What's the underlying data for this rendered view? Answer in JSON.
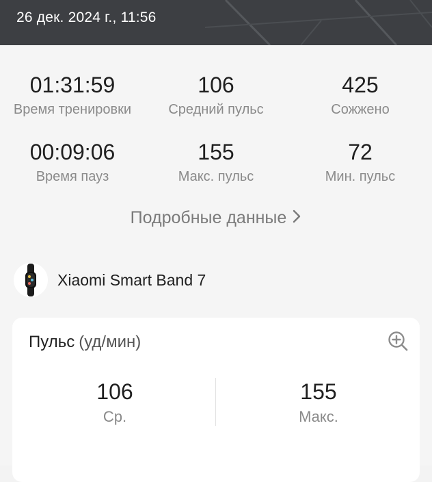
{
  "header": {
    "datetime": "26 дек. 2024 г., 11:56"
  },
  "stats": [
    {
      "value": "01:31:59",
      "label": "Время тренировки"
    },
    {
      "value": "106",
      "label": "Средний пульс"
    },
    {
      "value": "425",
      "label": "Сожжено"
    },
    {
      "value": "00:09:06",
      "label": "Время пауз"
    },
    {
      "value": "155",
      "label": "Макс. пульс"
    },
    {
      "value": "72",
      "label": "Мин. пульс"
    }
  ],
  "details_link": {
    "label": "Подробные данные",
    "icon": "chevron-right-icon"
  },
  "device": {
    "name": "Xiaomi Smart Band 7",
    "icon": "smart-band-icon"
  },
  "pulse_card": {
    "title": "Пульс",
    "unit": "(уд/мин)",
    "zoom_icon": "zoom-in-icon",
    "avg_value": "106",
    "avg_label": "Ср.",
    "max_value": "155",
    "max_label": "Макс."
  }
}
